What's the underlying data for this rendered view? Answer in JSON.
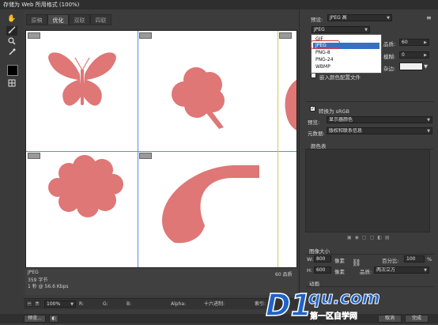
{
  "window": {
    "title": "存储为 Web 所用格式 (100%)"
  },
  "tools": [
    "hand-tool",
    "slice-select-tool",
    "zoom-tool",
    "eyedropper-tool",
    "eyedropper-color",
    "toggle-slices"
  ],
  "tabs": [
    {
      "label": "原稿",
      "active": false
    },
    {
      "label": "优化",
      "active": true
    },
    {
      "label": "双联",
      "active": false
    },
    {
      "label": "四联",
      "active": false
    }
  ],
  "canvas": {
    "shape_color": "#de7776",
    "shapes": [
      "butterfly",
      "clover",
      "cloud",
      "moon"
    ]
  },
  "info": {
    "format": "JPEG",
    "size": "359 字节",
    "time": "1 秒 @ 56.6 Kbps",
    "quality": "60 品质"
  },
  "bottom_bar": {
    "zoom": "100%",
    "r_label": "R:",
    "g_label": "G:",
    "b_label": "B:",
    "alpha_label": "Alpha:",
    "hex_label": "十六进制:",
    "index_label": "索引:"
  },
  "status_bar": {
    "preview": "预览...",
    "cancel": "取消",
    "done": "完成"
  },
  "panel": {
    "preset_label": "预设:",
    "preset_value": "JPEG 高",
    "format_value": "JPEG",
    "format_options": [
      "GIF",
      "JPEG",
      "PNG-8",
      "PNG-24",
      "WBMP"
    ],
    "format_selected": "JPEG",
    "quality_label": "品质:",
    "quality_value": "60",
    "blur_label": "模糊:",
    "blur_value": "0",
    "matte_label": "杂边:",
    "embed_profile": "嵌入颜色配置文件",
    "convert_srgb": "转换为 sRGB",
    "preview_label": "预览:",
    "preview_value": "显示器颜色",
    "metadata_label": "元数据:",
    "metadata_value": "版权和联系信息",
    "color_table_title": "颜色表",
    "image_size_title": "图像大小",
    "w_label": "W:",
    "w_value": "800",
    "w_unit": "像素",
    "h_label": "H:",
    "h_value": "600",
    "h_unit": "像素",
    "percent_label": "百分比:",
    "percent_value": "100",
    "percent_unit": "%",
    "quality2_label": "品质:",
    "quality2_value": "两次立方",
    "animation_title": "动画"
  },
  "watermark": {
    "text": "qu.com",
    "sub": "第一区自学网"
  }
}
